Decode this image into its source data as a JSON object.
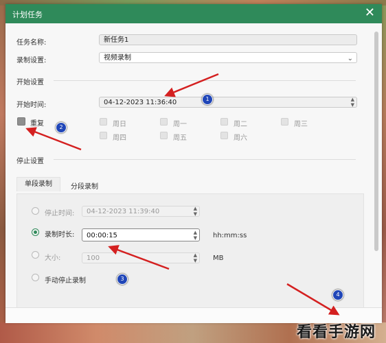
{
  "dialog": {
    "title": "计划任务",
    "task_name_label": "任务名称:",
    "task_name_value": "新任务1",
    "record_setting_label": "录制设置:",
    "record_setting_value": "视频录制",
    "start_section": "开始设置",
    "start_time_label": "开始时间:",
    "start_time_value": "04-12-2023 11:36:40",
    "repeat_label": "重复",
    "weekdays": [
      "周日",
      "周一",
      "周二",
      "周三",
      "周四",
      "周五",
      "周六"
    ],
    "stop_section": "停止设置",
    "tabs": [
      "单段录制",
      "分段录制"
    ],
    "stop_time_label": "停止时间:",
    "stop_time_value": "04-12-2023 11:39:40",
    "duration_label": "录制时长:",
    "duration_value": "00:00:15",
    "duration_unit": "hh:mm:ss",
    "size_label": "大小:",
    "size_value": "100",
    "size_unit": "MB",
    "manual_stop_label": "手动停止录制"
  },
  "annotations": [
    "1",
    "2",
    "3",
    "4"
  ],
  "watermark": "看看手游网",
  "colors": {
    "accent": "#2f8a5a",
    "arrow": "#d42020",
    "badge": "#2046b8"
  }
}
